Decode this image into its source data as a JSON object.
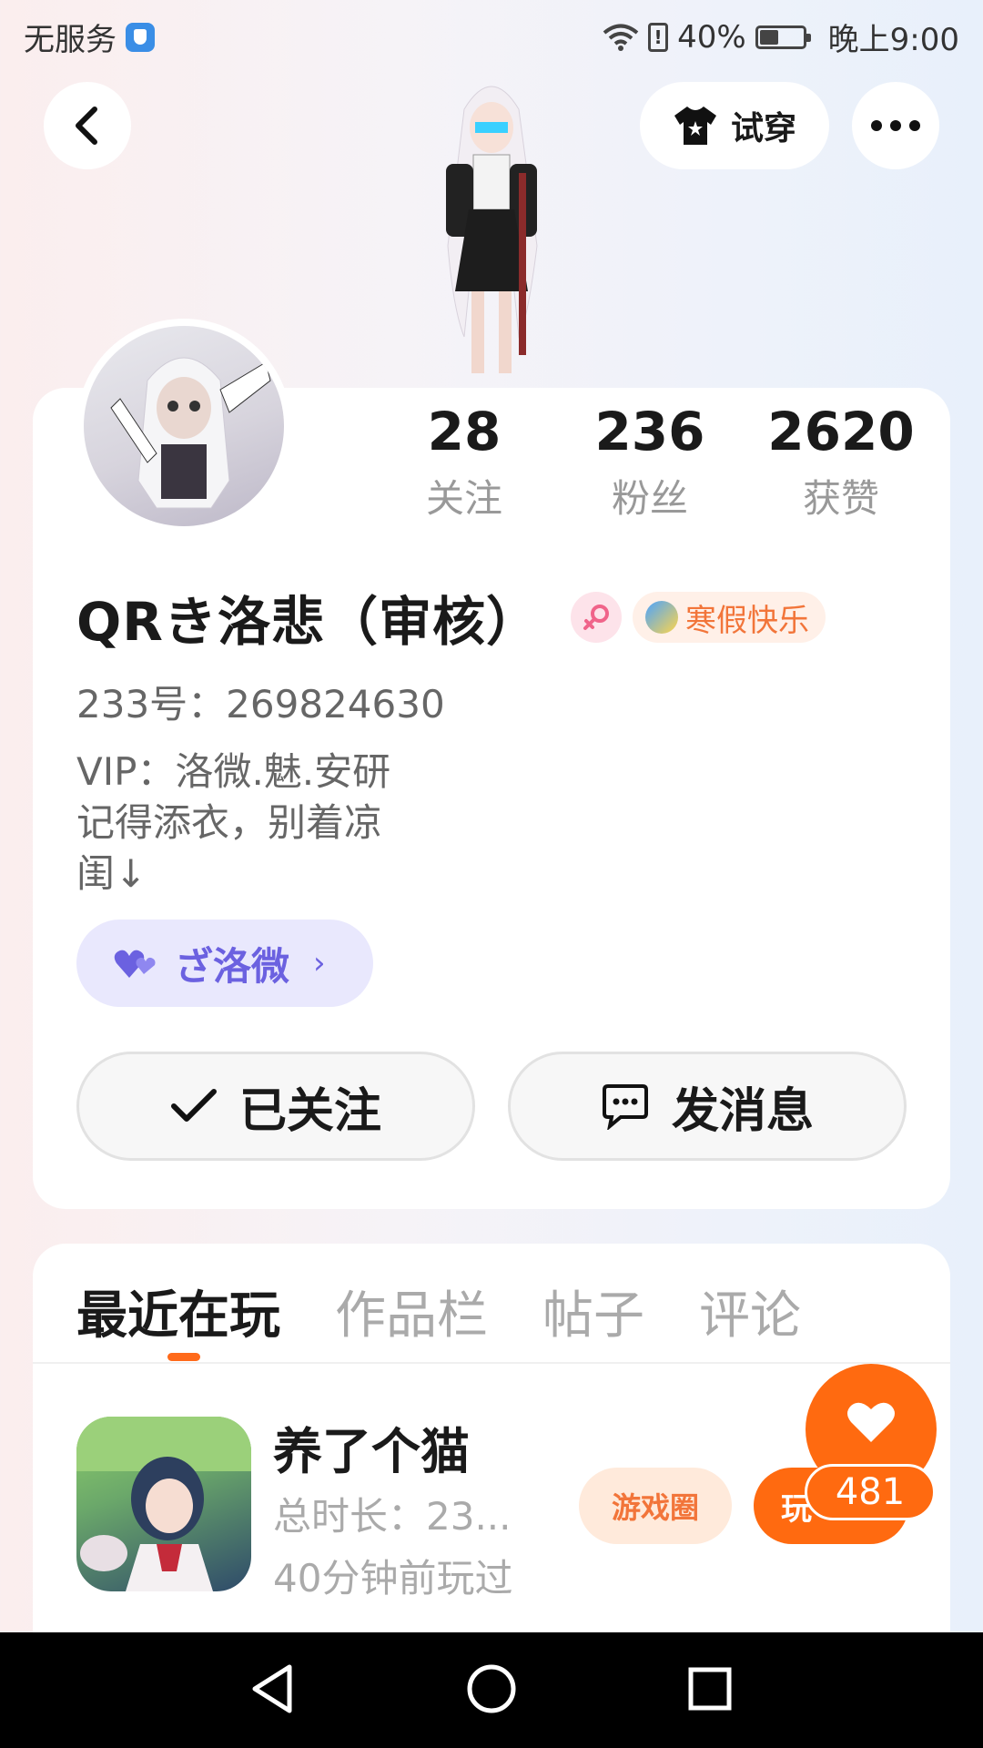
{
  "status_bar": {
    "carrier": "无服务",
    "battery": "40%",
    "time": "晚上9:00"
  },
  "header": {
    "try_on_label": "试穿"
  },
  "profile": {
    "stats": [
      {
        "value": "28",
        "label": "关注"
      },
      {
        "value": "236",
        "label": "粉丝"
      },
      {
        "value": "2620",
        "label": "获赞"
      }
    ],
    "name": "QRき洛悲（审核）",
    "badge": "寒假快乐",
    "uid": "233号：269824630",
    "bio": [
      "VIP：洛微.魅.安研",
      "记得添衣，别着凉",
      "闺↓"
    ],
    "tag": "ざ洛微",
    "follow_label": "已关注",
    "message_label": "发消息"
  },
  "tabs": [
    "最近在玩",
    "作品栏",
    "帖子",
    "评论"
  ],
  "recent_game": {
    "title": "养了个猫",
    "duration": "总时长：23...",
    "last_played": "40分钟前玩过",
    "circle_label": "游戏圈",
    "play_label": "玩"
  },
  "like": {
    "count": "481"
  },
  "colors": {
    "accent_orange": "#ff6a10",
    "tag_purple": "#6b61e0"
  }
}
